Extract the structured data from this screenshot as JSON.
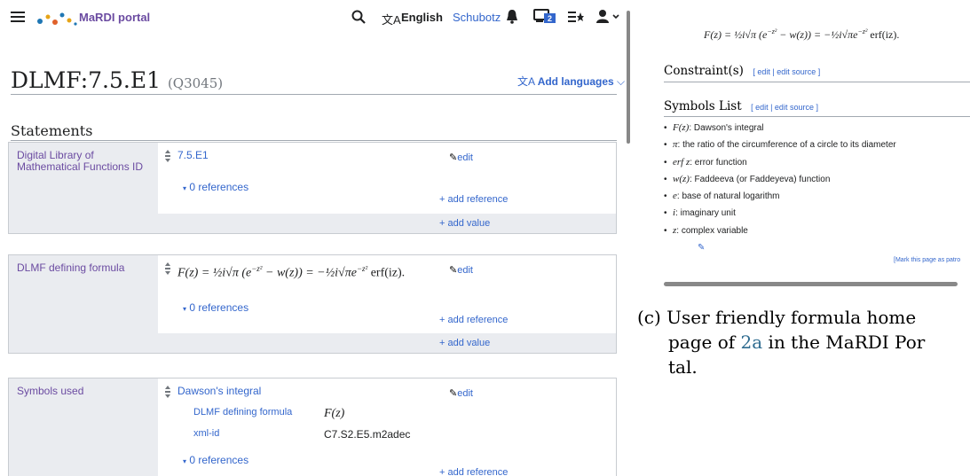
{
  "header": {
    "site_name": "MaRDI portal",
    "language": "English",
    "user": "Schubotz",
    "notifications_badge": "2"
  },
  "page": {
    "title": "DLMF:7.5.E1",
    "qid": "(Q3045)",
    "add_languages": "Add languages",
    "statements_heading": "Statements"
  },
  "statements": [
    {
      "property": "Digital Library of Mathematical Functions ID",
      "value": "7.5.E1",
      "edit": "edit",
      "references": "0 references",
      "add_reference": "+ add reference",
      "add_value": "+ add value"
    },
    {
      "property": "DLMF defining formula",
      "value_formula_lhs": "F(z) = ½i√π (e",
      "value_formula_mid": "−z²",
      "value_formula_rhs": " − w(z)) = −½i√πe",
      "value_formula_end": " erf(iz).",
      "edit": "edit",
      "references": "0 references",
      "add_reference": "+ add reference",
      "add_value": "+ add value"
    },
    {
      "property": "Symbols used",
      "value": "Dawson's integral",
      "edit": "edit",
      "qualifiers": [
        {
          "property": "DLMF defining formula",
          "value": "F(z)"
        },
        {
          "property": "xml-id",
          "value": "C7.S2.E5.m2adec"
        }
      ],
      "references": "0 references",
      "add_reference": "+ add reference"
    }
  ],
  "right": {
    "formula_top": "F(z) = ½i√π (e",
    "formula_top_exp": "−z²",
    "formula_top_rest": " − w(z)) = −½i√πe",
    "formula_top_end": " erf(iz).",
    "constraints_heading": "Constraint(s)",
    "symbols_heading": "Symbols List",
    "edit_links": "[ edit | edit source ]",
    "symbols": [
      {
        "sym": "F(z)",
        "desc": ": Dawson's integral"
      },
      {
        "sym": "π",
        "desc": ": the ratio of the circumference of a circle to its diameter"
      },
      {
        "sym": "erf z",
        "desc": ": error function"
      },
      {
        "sym": "w(z)",
        "desc": ": Faddeeva (or Faddeyeva) function"
      },
      {
        "sym": "e",
        "desc": ": base of natural logarithm"
      },
      {
        "sym": "i",
        "desc": ": imaginary unit"
      },
      {
        "sym": "z",
        "desc": ": complex variable"
      }
    ],
    "patrol_link": "[Mark this page as patro",
    "caption_label": "(c)",
    "caption_line1": "User friendly formula home",
    "caption_line2a": "page of ",
    "caption_ref": "2a",
    "caption_line2b": " in the MaRDI Por",
    "caption_line3": "tal."
  },
  "colors": {
    "link": "#3366cc",
    "property_purple": "#6b4ba1",
    "panel_grey": "#eaecf0",
    "border": "#c8ccd1"
  }
}
